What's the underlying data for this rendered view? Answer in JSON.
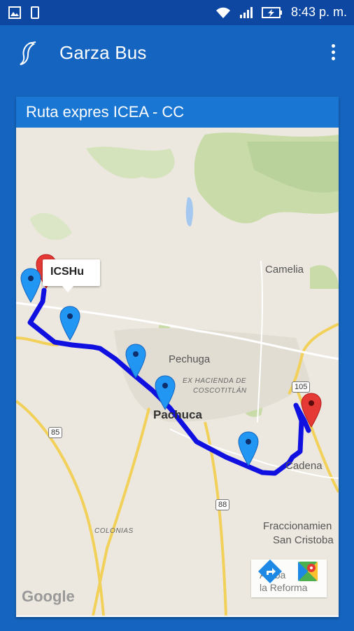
{
  "status_bar": {
    "time": "8:43 p. m."
  },
  "app": {
    "title": "Garza Bus"
  },
  "card": {
    "title": "Ruta expres ICEA - CC"
  },
  "map": {
    "labels": {
      "camelia": "Camelia",
      "pechuga": "Pechuga",
      "hacienda_line1": "EX HACIENDA DE",
      "hacienda_line2": "COSCOTITLÁN",
      "pachuca": "Pachuca",
      "cadena": "Cadena",
      "colonias": "COLONIAS",
      "fracc_line1": "Fraccionamien",
      "fracc_line2": "San Cristoba",
      "reforma_line1": "Arriba",
      "reforma_line2": "la Reforma"
    },
    "route_shields": [
      "85",
      "88",
      "105"
    ],
    "info_window": "ICSHu",
    "attribution": "Google",
    "route_color": "#1010e0",
    "stop_marker_color": "#2196f3",
    "destination_marker_color": "#e53935"
  }
}
